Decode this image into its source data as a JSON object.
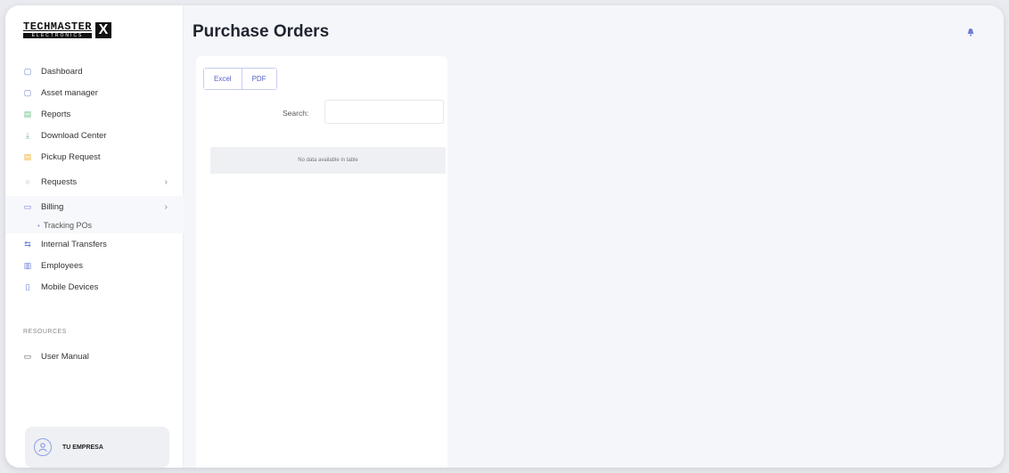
{
  "brand": {
    "name": "TECHMASTER",
    "sub": "ELECTRONICS",
    "mark": "X"
  },
  "sidebar": {
    "items": [
      {
        "label": "Dashboard",
        "icon": "dashboard-icon",
        "glyph": "▢"
      },
      {
        "label": "Asset manager",
        "icon": "asset-icon",
        "glyph": "▢"
      },
      {
        "label": "Reports",
        "icon": "reports-icon",
        "glyph": "▤"
      },
      {
        "label": "Download Center",
        "icon": "download-icon",
        "glyph": "⤓"
      },
      {
        "label": "Pickup Request",
        "icon": "pickup-icon",
        "glyph": "▤"
      },
      {
        "label": "Requests",
        "icon": "requests-icon",
        "glyph": "○",
        "chevron": "›"
      },
      {
        "label": "Billing",
        "icon": "billing-icon",
        "glyph": "▭",
        "chevron": "›"
      },
      {
        "label": "Internal Transfers",
        "icon": "transfer-icon",
        "glyph": "⇆"
      },
      {
        "label": "Employees",
        "icon": "employees-icon",
        "glyph": "▥"
      },
      {
        "label": "Mobile Devices",
        "icon": "mobile-icon",
        "glyph": "▯"
      }
    ],
    "billing_sub": {
      "label": "Tracking POs"
    },
    "resources_title": "RESOURCES",
    "manual": {
      "label": "User Manual",
      "glyph": "▭"
    },
    "company": "TU EMPRESA"
  },
  "main": {
    "title": "Purchase Orders",
    "export_buttons": [
      "Excel",
      "PDF"
    ],
    "search_label": "Search:",
    "search_value": "",
    "empty_message": "No data available in table"
  },
  "colors": {
    "accent": "#6a7bd8",
    "title": "#1f2430"
  }
}
